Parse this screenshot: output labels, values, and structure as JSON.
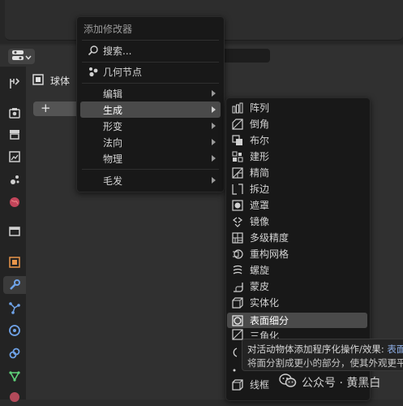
{
  "header": {
    "object_name": "球体",
    "add_button": "+"
  },
  "menu1": {
    "title": "添加修改器",
    "search_label": "搜索...",
    "geometry_nodes": "几何节点",
    "items": [
      {
        "label": "编辑",
        "submenu": true
      },
      {
        "label": "生成",
        "submenu": true,
        "highlighted": true
      },
      {
        "label": "形变",
        "submenu": true
      },
      {
        "label": "法向",
        "submenu": true
      },
      {
        "label": "物理",
        "submenu": true
      },
      {
        "label": "毛发",
        "submenu": true
      }
    ]
  },
  "menu2": {
    "items": [
      {
        "label": "阵列",
        "icon": "array-icon"
      },
      {
        "label": "倒角",
        "icon": "bevel-icon"
      },
      {
        "label": "布尔",
        "icon": "boolean-icon"
      },
      {
        "label": "建形",
        "icon": "build-icon"
      },
      {
        "label": "精简",
        "icon": "decimate-icon"
      },
      {
        "label": "拆边",
        "icon": "edge-split-icon"
      },
      {
        "label": "遮罩",
        "icon": "mask-icon"
      },
      {
        "label": "镜像",
        "icon": "mirror-icon"
      },
      {
        "label": "多级精度",
        "icon": "multires-icon"
      },
      {
        "label": "重构网格",
        "icon": "remesh-icon"
      },
      {
        "label": "螺旋",
        "icon": "screw-icon"
      },
      {
        "label": "蒙皮",
        "icon": "skin-icon"
      },
      {
        "label": "实体化",
        "icon": "solidify-icon"
      },
      {
        "label": "表面细分",
        "icon": "subdivision-icon",
        "highlighted": true
      },
      {
        "label": "三角化",
        "icon": "triangulate-icon"
      },
      {
        "label": "线框",
        "icon": "wireframe-icon"
      }
    ]
  },
  "tooltip": {
    "line1_prefix": "对活动物体添加程序化操作/效果: ",
    "line1_highlight": "表面细",
    "line2": "将面分割成更小的部分，使其外观更平滑"
  },
  "watermark": {
    "text": "公众号 · 黄黑白"
  },
  "colors": {
    "menu_bg": "#181818",
    "highlight": "#4a4a4a",
    "panel_bg": "#303030",
    "tab_bg": "#232323",
    "tooltip_highlight": "#8fb0e8"
  }
}
